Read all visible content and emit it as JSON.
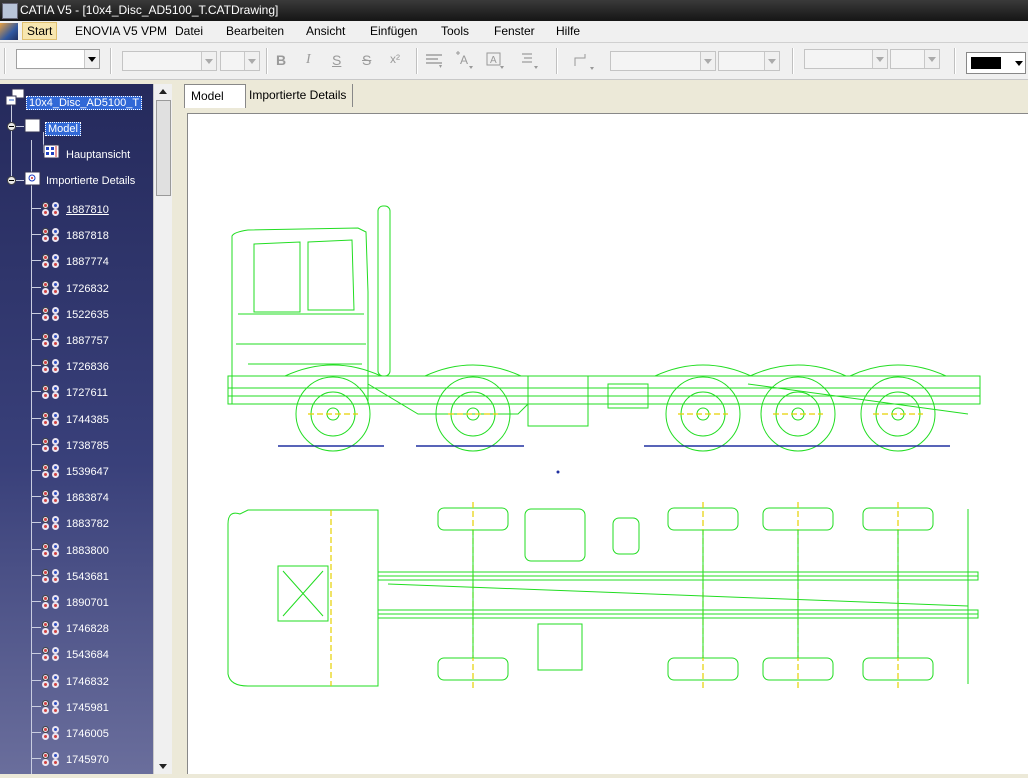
{
  "window": {
    "title": "CATIA V5 - [10x4_Disc_AD5100_T.CATDrawing]"
  },
  "menu": {
    "items": [
      "Start",
      "ENOVIA V5 VPM",
      "Datei",
      "Bearbeiten",
      "Ansicht",
      "Einfügen",
      "Tools",
      "Fenster",
      "Hilfe"
    ]
  },
  "toolbar": {
    "font_name": "",
    "font_size": "",
    "bold": "B",
    "italic": "I",
    "strike_s": "S",
    "strike_s2": "S",
    "superscript": "x²",
    "text_color": "#000000"
  },
  "tree": {
    "root": "10x4_Disc_AD5100_T",
    "sheets": [
      {
        "label": "Model",
        "views": [
          "Hauptansicht"
        ]
      },
      {
        "label": "Importierte Details"
      }
    ],
    "details": [
      "1887810",
      "1887818",
      "1887774",
      "1726832",
      "1522635",
      "1887757",
      "1726836",
      "1727611",
      "1744385",
      "1738785",
      "1539647",
      "1883874",
      "1883782",
      "1883800",
      "1543681",
      "1890701",
      "1746828",
      "1543684",
      "1746832",
      "1745981",
      "1746005",
      "1745970"
    ]
  },
  "tabs": [
    {
      "label": "Model",
      "active": true
    },
    {
      "label": "Importierte Details",
      "active": false
    }
  ],
  "drawing": {
    "line_color": "#22DD22",
    "axis_color": "#E6D000",
    "ground_color": "#2030A0"
  }
}
